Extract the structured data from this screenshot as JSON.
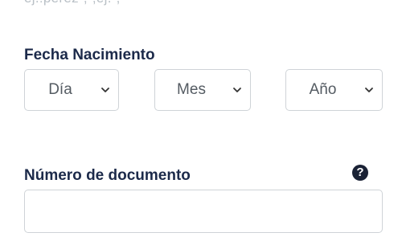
{
  "form": {
    "cut_off_text": "ej.:pérez·,·,ej.·,·"
  },
  "birth_date": {
    "label": "Fecha Nacimiento",
    "day_select": {
      "value": "Día"
    },
    "month_select": {
      "value": "Mes"
    },
    "year_select": {
      "value": "Año"
    }
  },
  "document": {
    "label": "Número de documento",
    "help_icon": "question-circle-icon",
    "input_value": "",
    "input_placeholder": ""
  },
  "colors": {
    "label_text": "#1c2a4a",
    "border": "#cfd3d7",
    "select_text": "#545b62",
    "help_icon_bg": "#1a2235"
  }
}
